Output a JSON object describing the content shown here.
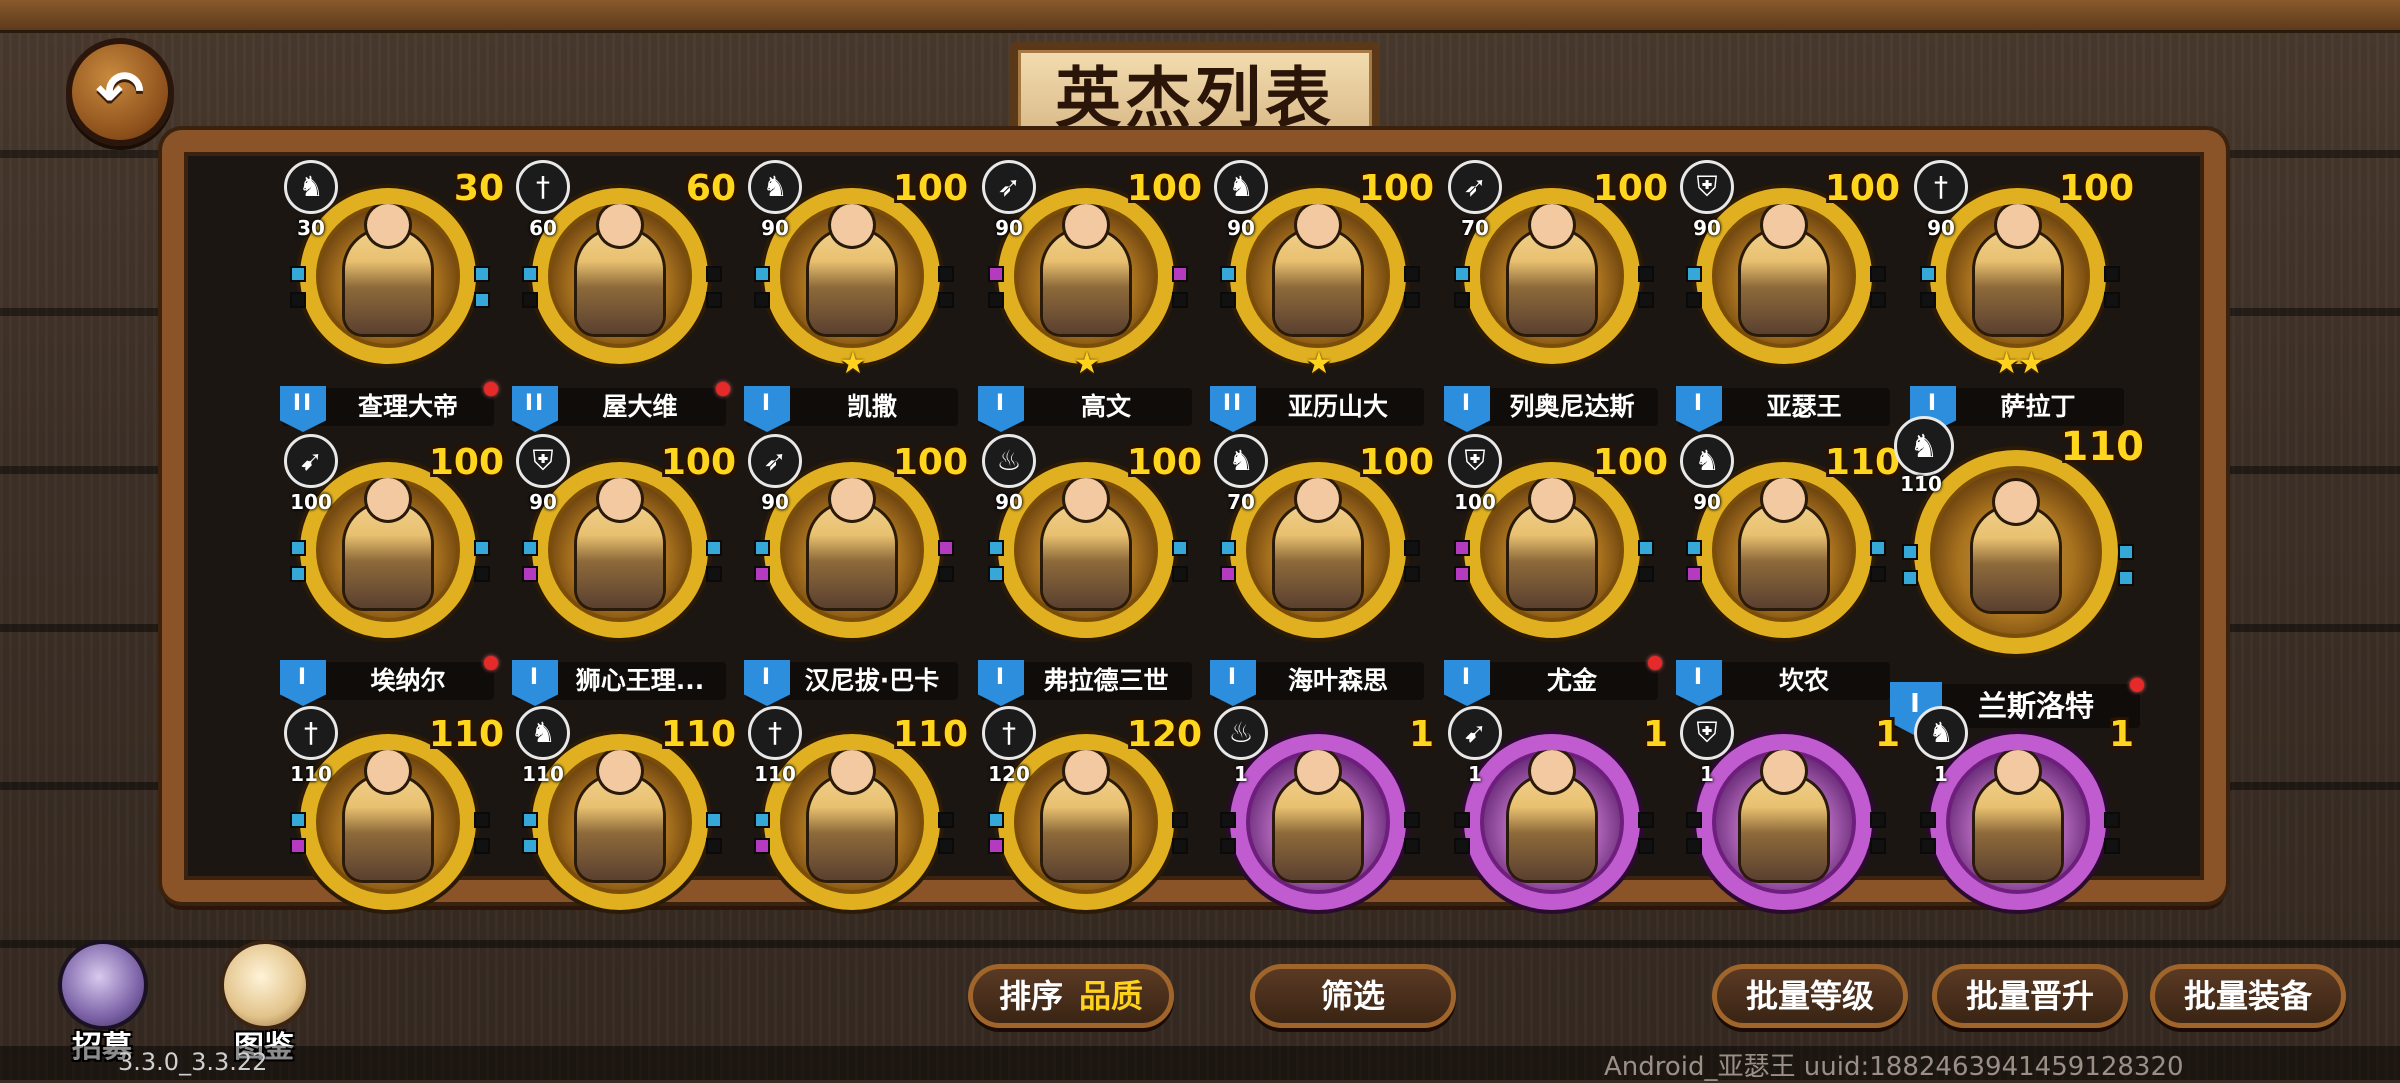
{
  "title": "英杰列表",
  "heroes": [
    {
      "name": "查理大帝",
      "level": "30",
      "class_icon": "cavalry-icon",
      "class_level": "30",
      "rank": "II",
      "stars": 0,
      "dot": true,
      "frame": "gold",
      "gems": {
        "left": [
          "b",
          "k"
        ],
        "right": [
          "b",
          "b"
        ]
      }
    },
    {
      "name": "屋大维",
      "level": "60",
      "class_icon": "sword-icon",
      "class_level": "60",
      "rank": "II",
      "stars": 0,
      "dot": true,
      "frame": "gold",
      "gems": {
        "left": [
          "b",
          "k"
        ],
        "right": [
          "k",
          "k"
        ]
      }
    },
    {
      "name": "凯撒",
      "level": "100",
      "class_icon": "cavalry-icon",
      "class_level": "90",
      "rank": "I",
      "stars": 1,
      "dot": false,
      "frame": "gold",
      "gems": {
        "left": [
          "b",
          "k"
        ],
        "right": [
          "k",
          "k"
        ]
      }
    },
    {
      "name": "高文",
      "level": "100",
      "class_icon": "spear-icon",
      "class_level": "90",
      "rank": "I",
      "stars": 1,
      "dot": false,
      "frame": "gold",
      "gems": {
        "left": [
          "p",
          "k"
        ],
        "right": [
          "p",
          "k"
        ]
      }
    },
    {
      "name": "亚历山大",
      "level": "100",
      "class_icon": "cavalry-icon",
      "class_level": "90",
      "rank": "II",
      "stars": 1,
      "dot": false,
      "frame": "gold",
      "gems": {
        "left": [
          "b",
          "k"
        ],
        "right": [
          "k",
          "k"
        ]
      }
    },
    {
      "name": "列奥尼达斯",
      "level": "100",
      "class_icon": "spear-icon",
      "class_level": "70",
      "rank": "I",
      "stars": 0,
      "dot": false,
      "frame": "gold",
      "gems": {
        "left": [
          "b",
          "k"
        ],
        "right": [
          "k",
          "k"
        ]
      }
    },
    {
      "name": "亚瑟王",
      "level": "100",
      "class_icon": "shield-icon",
      "class_level": "90",
      "rank": "I",
      "stars": 0,
      "dot": false,
      "frame": "gold",
      "gems": {
        "left": [
          "b",
          "k"
        ],
        "right": [
          "k",
          "k"
        ]
      }
    },
    {
      "name": "萨拉丁",
      "level": "100",
      "class_icon": "sword-icon",
      "class_level": "90",
      "rank": "I",
      "stars": 2,
      "dot": false,
      "frame": "gold",
      "gems": {
        "left": [
          "b",
          "k"
        ],
        "right": [
          "k",
          "k"
        ]
      }
    },
    {
      "name": "埃纳尔",
      "level": "100",
      "class_icon": "bow-icon",
      "class_level": "100",
      "rank": "I",
      "stars": 0,
      "dot": true,
      "frame": "gold",
      "gems": {
        "left": [
          "b",
          "b"
        ],
        "right": [
          "b",
          "k"
        ]
      }
    },
    {
      "name": "狮心王理...",
      "level": "100",
      "class_icon": "shield-icon",
      "class_level": "90",
      "rank": "I",
      "stars": 0,
      "dot": false,
      "frame": "gold",
      "gems": {
        "left": [
          "b",
          "p"
        ],
        "right": [
          "b",
          "k"
        ]
      }
    },
    {
      "name": "汉尼拔·巴卡",
      "level": "100",
      "class_icon": "spear-icon",
      "class_level": "90",
      "rank": "I",
      "stars": 0,
      "dot": false,
      "frame": "gold",
      "gems": {
        "left": [
          "b",
          "p"
        ],
        "right": [
          "p",
          "k"
        ]
      }
    },
    {
      "name": "弗拉德三世",
      "level": "100",
      "class_icon": "fire-icon",
      "class_level": "90",
      "rank": "I",
      "stars": 0,
      "dot": false,
      "frame": "gold",
      "gems": {
        "left": [
          "b",
          "b"
        ],
        "right": [
          "b",
          "k"
        ]
      }
    },
    {
      "name": "海叶森思",
      "level": "100",
      "class_icon": "cavalry-icon",
      "class_level": "70",
      "rank": "I",
      "stars": 0,
      "dot": false,
      "frame": "gold",
      "gems": {
        "left": [
          "b",
          "p"
        ],
        "right": [
          "k",
          "k"
        ]
      }
    },
    {
      "name": "尤金",
      "level": "100",
      "class_icon": "shield-icon",
      "class_level": "100",
      "rank": "I",
      "stars": 0,
      "dot": true,
      "frame": "gold",
      "gems": {
        "left": [
          "p",
          "p"
        ],
        "right": [
          "b",
          "k"
        ]
      }
    },
    {
      "name": "坎农",
      "level": "110",
      "class_icon": "cavalry-icon",
      "class_level": "90",
      "rank": "I",
      "stars": 0,
      "dot": false,
      "frame": "gold",
      "gems": {
        "left": [
          "b",
          "p"
        ],
        "right": [
          "b",
          "k"
        ]
      }
    },
    {
      "name": "兰斯洛特",
      "level": "110",
      "class_icon": "cavalry-icon",
      "class_level": "110",
      "rank": "I",
      "stars": 0,
      "dot": true,
      "frame": "gold",
      "big": true,
      "gems": {
        "left": [
          "b",
          "b"
        ],
        "right": [
          "b",
          "b"
        ]
      }
    },
    {
      "name": "",
      "level": "110",
      "class_icon": "sword-icon",
      "class_level": "110",
      "rank": "",
      "stars": 0,
      "dot": false,
      "frame": "gold",
      "gems": {
        "left": [
          "b",
          "p"
        ],
        "right": [
          "k",
          "k"
        ]
      }
    },
    {
      "name": "",
      "level": "110",
      "class_icon": "cavalry-icon",
      "class_level": "110",
      "rank": "",
      "stars": 0,
      "dot": false,
      "frame": "gold",
      "gems": {
        "left": [
          "b",
          "b"
        ],
        "right": [
          "b",
          "k"
        ]
      }
    },
    {
      "name": "",
      "level": "110",
      "class_icon": "sword-icon",
      "class_level": "110",
      "rank": "",
      "stars": 0,
      "dot": false,
      "frame": "gold",
      "gems": {
        "left": [
          "b",
          "p"
        ],
        "right": [
          "k",
          "k"
        ]
      }
    },
    {
      "name": "",
      "level": "120",
      "class_icon": "sword-icon",
      "class_level": "120",
      "rank": "",
      "stars": 0,
      "dot": false,
      "frame": "gold",
      "gems": {
        "left": [
          "b",
          "p"
        ],
        "right": [
          "k",
          "k"
        ]
      }
    },
    {
      "name": "",
      "level": "1",
      "class_icon": "fire-icon",
      "class_level": "1",
      "rank": "",
      "stars": 0,
      "dot": false,
      "frame": "purple",
      "gems": {
        "left": [
          "k",
          "k"
        ],
        "right": [
          "k",
          "k"
        ]
      }
    },
    {
      "name": "",
      "level": "1",
      "class_icon": "bow-icon",
      "class_level": "1",
      "rank": "",
      "stars": 0,
      "dot": false,
      "frame": "purple",
      "gems": {
        "left": [
          "k",
          "k"
        ],
        "right": [
          "k",
          "k"
        ]
      }
    },
    {
      "name": "",
      "level": "1",
      "class_icon": "shield-icon",
      "class_level": "1",
      "rank": "",
      "stars": 0,
      "dot": false,
      "frame": "purple",
      "gems": {
        "left": [
          "k",
          "k"
        ],
        "right": [
          "k",
          "k"
        ]
      }
    },
    {
      "name": "",
      "level": "1",
      "class_icon": "cavalry-icon",
      "class_level": "1",
      "rank": "",
      "stars": 0,
      "dot": false,
      "frame": "purple",
      "gems": {
        "left": [
          "k",
          "k"
        ],
        "right": [
          "k",
          "k"
        ]
      }
    }
  ],
  "recruit_label": "招募",
  "codex_label": "图鉴",
  "sort_label": "排序",
  "sort_value": "品质",
  "filter_label": "筛选",
  "batch_level_label": "批量等级",
  "batch_promote_label": "批量晋升",
  "batch_equip_label": "批量装备",
  "version": "3.3.0_3.3.22",
  "uid_text": "Android_亚瑟王 uuid:1882463941459128320",
  "colors": {
    "gold_frame": "#e0b021",
    "purple_frame": "#c05ccf",
    "rank_blue": "#2e8ede",
    "level_yellow": "#ffd61e"
  }
}
